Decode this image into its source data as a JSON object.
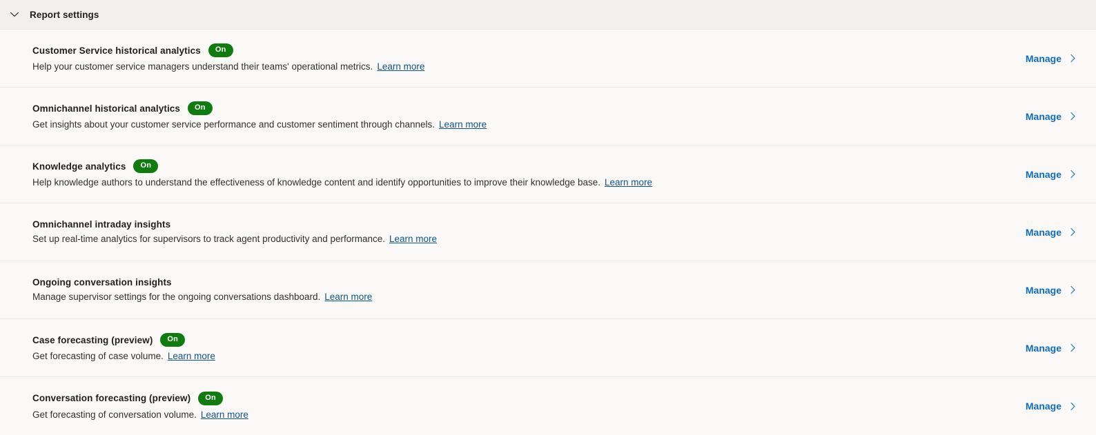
{
  "section": {
    "title": "Report settings",
    "expanded": true,
    "collapse_icon": "chevron-down-icon"
  },
  "colors": {
    "badge_on_background": "#107c10",
    "badge_on_text": "#ffffff",
    "manage_link": "#0f6cbd",
    "learn_more_link": "#0f548c",
    "header_background": "#f1f0ef",
    "body_background": "#faf9f8",
    "divider": "#edebe9",
    "title_text": "#201f1e",
    "description_text": "#323130"
  },
  "common": {
    "manage_label": "Manage",
    "manage_icon": "chevron-right-icon",
    "learn_more_label": "Learn more",
    "badge_on_label": "On"
  },
  "rows": [
    {
      "title": "Customer Service historical analytics",
      "badge": "On",
      "has_badge": true,
      "description": "Help your customer service managers understand their teams' operational metrics.",
      "learn_more": "Learn more",
      "action_label": "Manage"
    },
    {
      "title": "Omnichannel historical analytics",
      "badge": "On",
      "has_badge": true,
      "description": "Get insights about your customer service performance and customer sentiment through channels.",
      "learn_more": "Learn more",
      "action_label": "Manage"
    },
    {
      "title": "Knowledge analytics",
      "badge": "On",
      "has_badge": true,
      "description": "Help knowledge authors to understand the effectiveness of knowledge content and identify opportunities to improve their knowledge base.",
      "learn_more": "Learn more",
      "action_label": "Manage"
    },
    {
      "title": "Omnichannel intraday insights",
      "badge": "",
      "has_badge": false,
      "description": "Set up real-time analytics for supervisors to track agent productivity and performance.",
      "learn_more": "Learn more",
      "action_label": "Manage"
    },
    {
      "title": "Ongoing conversation insights",
      "badge": "",
      "has_badge": false,
      "description": "Manage supervisor settings for the ongoing conversations dashboard.",
      "learn_more": "Learn more",
      "action_label": "Manage"
    },
    {
      "title": "Case forecasting (preview)",
      "badge": "On",
      "has_badge": true,
      "description": "Get forecasting of case volume.",
      "learn_more": "Learn more",
      "action_label": "Manage"
    },
    {
      "title": "Conversation forecasting (preview)",
      "badge": "On",
      "has_badge": true,
      "description": "Get forecasting of conversation volume.",
      "learn_more": "Learn more",
      "action_label": "Manage"
    }
  ]
}
